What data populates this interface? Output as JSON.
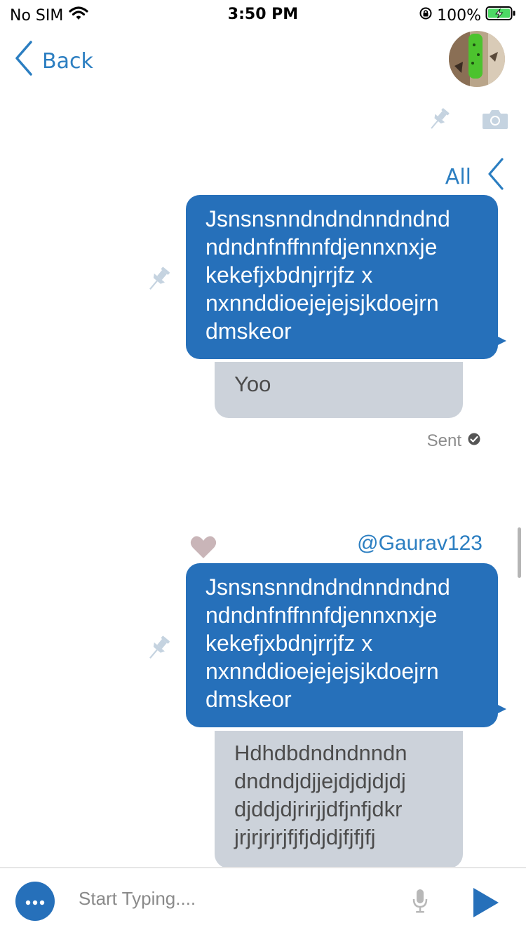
{
  "status_bar": {
    "carrier": "No SIM",
    "time": "3:50 PM",
    "battery": "100%",
    "icons": [
      "wifi-icon",
      "orientation-lock-icon",
      "battery-charging-icon"
    ]
  },
  "nav": {
    "back_label": "Back",
    "icons": [
      "back-chevron-icon",
      "avatar"
    ]
  },
  "toolbar": {
    "icons": [
      "pin-icon",
      "camera-icon"
    ]
  },
  "filter": {
    "label": "All",
    "icon": "chevron-left-icon"
  },
  "messages": [
    {
      "text_lines": [
        "Jsnsnsnndndndnndndnd",
        "ndndnfnffnnfdjennxnxje",
        "kekefjxbdnjrrjfz x",
        "nxnnddioejejejsjkdoejrn",
        "dmskeor"
      ],
      "reply_lines": [
        "Yoo"
      ],
      "status": "Sent"
    },
    {
      "mention": "@Gaurav123",
      "text_lines": [
        "Jsnsnsnndndndnndndnd",
        "ndndnfnffnnfdjennxnxje",
        "kekefjxbdnjrrjfz x",
        "nxnnddioejejejsjkdoejrn",
        "dmskeor"
      ],
      "reply_lines": [
        "Hdhdbdndndnndn",
        "dndndjdjjejdjdjdjdj",
        "djddjdjrirjjdfjnfjdkr",
        "jrjrjrjrjfjfjdjdjfjfjfj"
      ]
    }
  ],
  "composer": {
    "placeholder": "Start Typing....",
    "icons": [
      "more-icon",
      "microphone-icon",
      "send-icon"
    ]
  },
  "colors": {
    "accent": "#2b7ec1",
    "bubble_blue": "#2670ba",
    "bubble_gray": "#ccd2da",
    "pin": "#c5d3e0",
    "heart": "#c9b5b8"
  }
}
